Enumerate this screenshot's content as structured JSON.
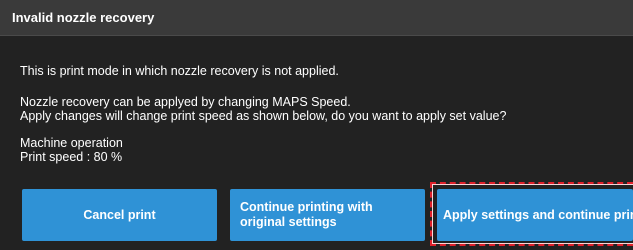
{
  "dialog": {
    "title": "Invalid nozzle recovery",
    "lines": [
      "This is print mode in which nozzle recovery is not applied.",
      "Nozzle recovery can be applyed by changing MAPS Speed.",
      "Apply changes will change print speed as shown below, do you want to apply set value?",
      "Machine operation",
      "Print speed : 80 %"
    ]
  },
  "buttons": {
    "cancel_label": "Cancel print",
    "continue_label": "Continue printing with original settings",
    "apply_label": "Apply settings and continue print"
  },
  "colors": {
    "background": "#222222",
    "titlebar": "#3a3a3a",
    "button": "#2f92d6",
    "highlight": "#e0202a"
  }
}
